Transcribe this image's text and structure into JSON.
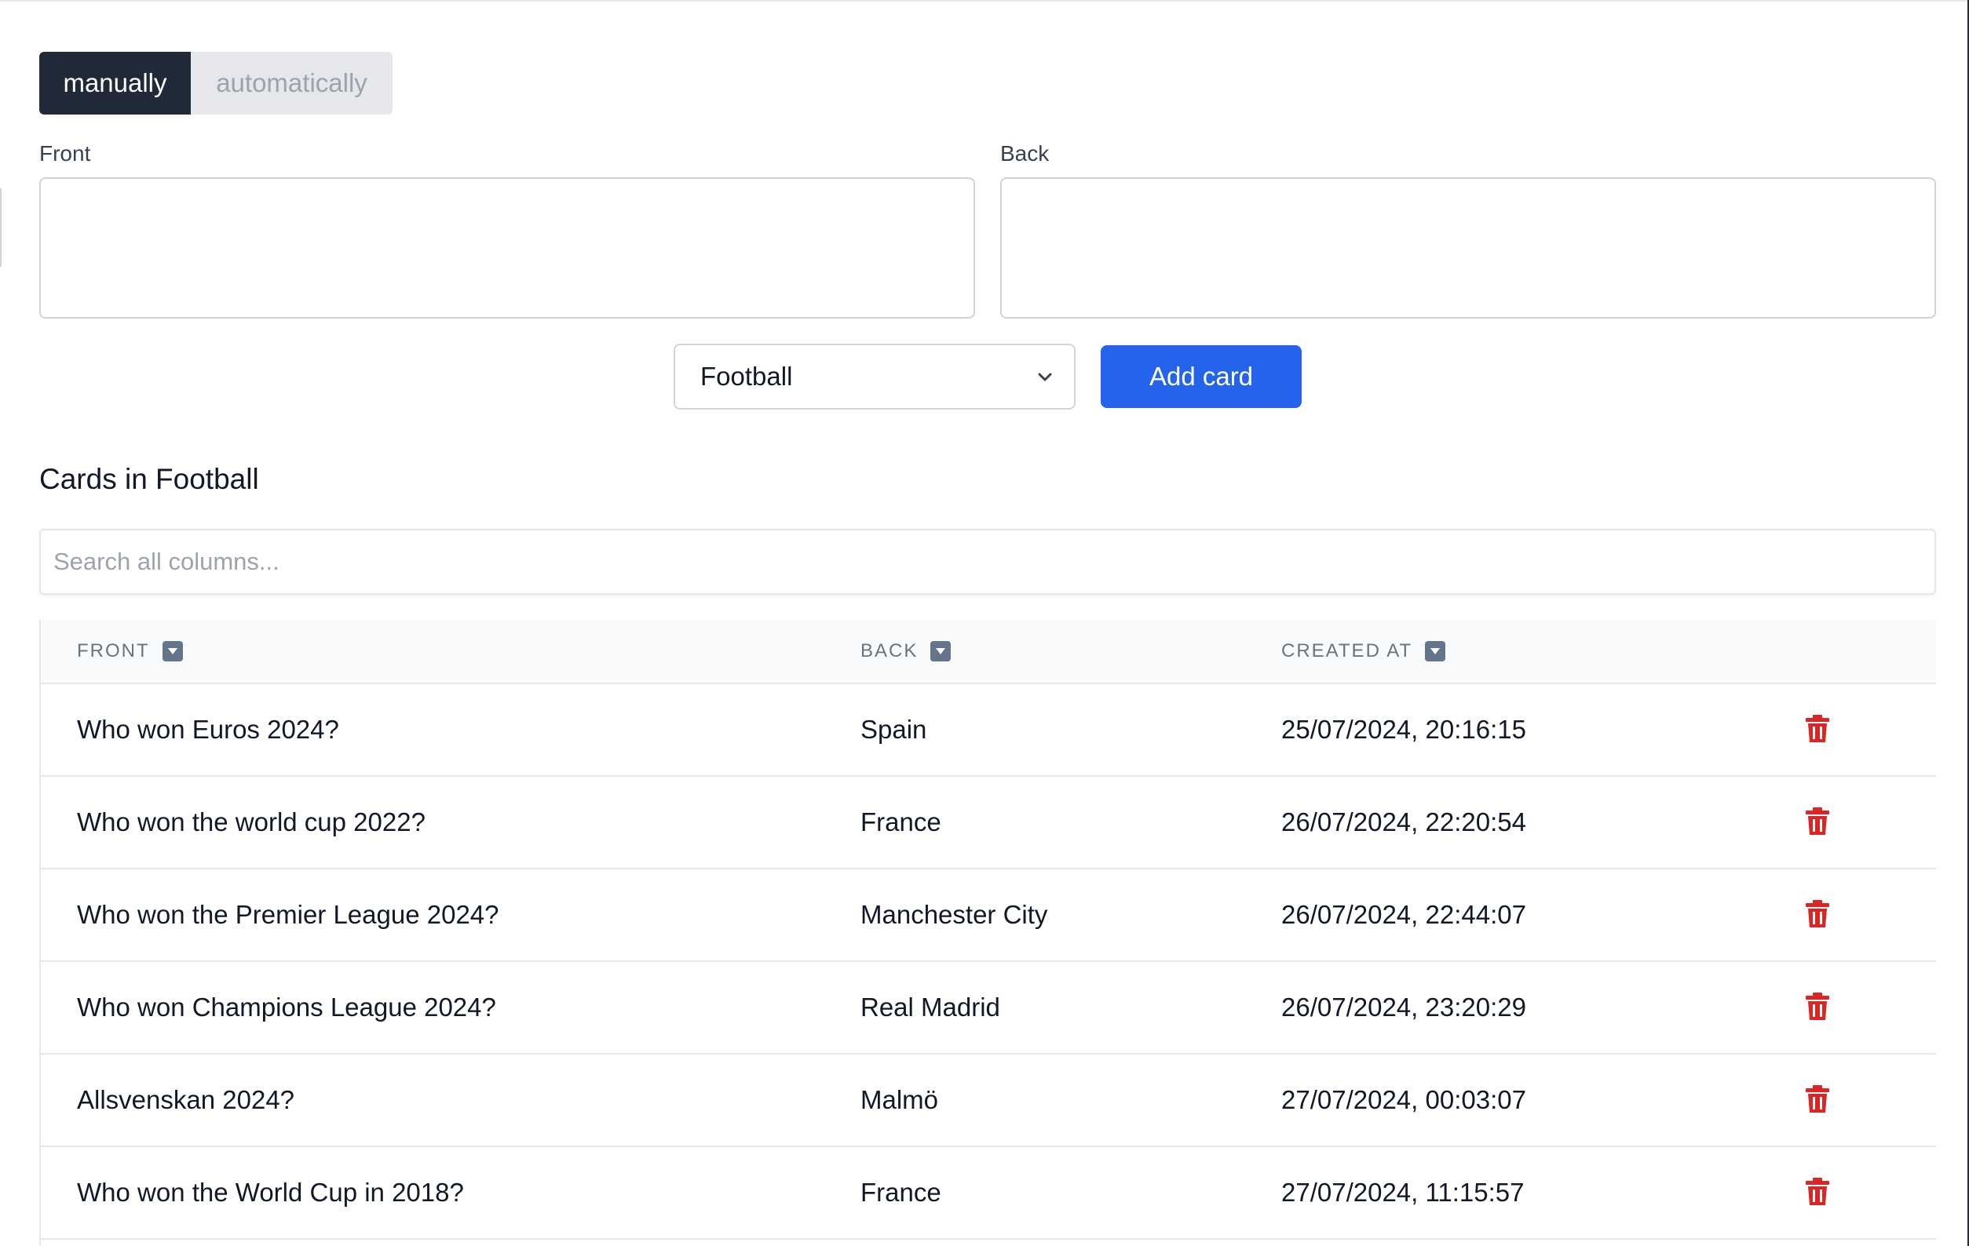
{
  "mode_toggle": {
    "manual_label": "manually",
    "auto_label": "automatically"
  },
  "form": {
    "front_label": "Front",
    "back_label": "Back",
    "front_value": "",
    "back_value": "",
    "deck_selected": "Football",
    "add_button_label": "Add card"
  },
  "section": {
    "title": "Cards in Football"
  },
  "search": {
    "placeholder": "Search all columns..."
  },
  "table": {
    "columns": [
      "FRONT",
      "BACK",
      "CREATED AT"
    ],
    "rows": [
      {
        "front": "Who won Euros 2024?",
        "back": "Spain",
        "created_at": "25/07/2024, 20:16:15"
      },
      {
        "front": "Who won the world cup 2022?",
        "back": "France",
        "created_at": "26/07/2024, 22:20:54"
      },
      {
        "front": "Who won the Premier League 2024?",
        "back": "Manchester City",
        "created_at": "26/07/2024, 22:44:07"
      },
      {
        "front": "Who won Champions League 2024?",
        "back": "Real Madrid",
        "created_at": "26/07/2024, 23:20:29"
      },
      {
        "front": "Allsvenskan 2024?",
        "back": "Malmö",
        "created_at": "27/07/2024, 00:03:07"
      },
      {
        "front": "Who won the World Cup in 2018?",
        "back": "France",
        "created_at": "27/07/2024, 11:15:57"
      }
    ]
  },
  "icons": {
    "sort": "sort-down-icon",
    "delete": "trash-icon",
    "select": "chevron-down-icon"
  },
  "colors": {
    "primary_button": "#2563eb",
    "active_toggle": "#1f2937",
    "delete_icon": "#dc2626"
  }
}
